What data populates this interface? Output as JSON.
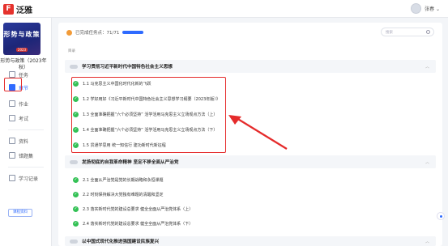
{
  "app": {
    "logo_text": "泛雅",
    "user_name": "张春 ⌄"
  },
  "course": {
    "cover_title": "形势与政策",
    "cover_sub": "2023",
    "name": "形势与政策（2023年秋）"
  },
  "sidebar": {
    "items": [
      {
        "label": "任务"
      },
      {
        "label": "章节"
      },
      {
        "label": "作业"
      },
      {
        "label": "考试"
      },
      {
        "label": "资料"
      },
      {
        "label": "错题集"
      },
      {
        "label": "学习记录"
      }
    ],
    "button_label": "课程资料"
  },
  "main": {
    "progress_text": "已完成任务点：71/71",
    "search_placeholder": "搜索",
    "dir_label": "目录",
    "sections": [
      {
        "title": "学习贯彻习近平新时代中国特色社会主义思想",
        "items": [
          "1.1 马克思主义中国化时代化新的飞跃",
          "1.2 学好用好《习近平新时代中国特色社会主义思想学习纲要（2023年版）》",
          "1.3 全面准确把握“六个必须坚持” 活学活用马克思主义立场观点方法（上）",
          "1.4 全面准确把握“六个必须坚持” 活学活用马克思主义立场观点方法（下）",
          "1.5 贯通学思用 统一知信行 建功新时代新征程"
        ]
      },
      {
        "title": "发扬彻底的自我革命精神 坚定不移全面从严治党",
        "items": [
          "2.1 全面从严治党是党的长期战略和永恒课题",
          "2.2 时刻保持解决大党独有难题的清醒和坚定",
          "2.3 落实新时代党的建设总要求 健全全面从严治党体系（上）",
          "2.4 落实新时代党的建设总要求 健全全面从严治党体系（下）"
        ]
      },
      {
        "title": "以中国式现代化推进强国建设民族复兴",
        "items": []
      }
    ]
  },
  "colors": {
    "accent": "#2f6bff",
    "check": "#33c155",
    "annotation": "#e52b2b",
    "brand": "#e5322d"
  }
}
